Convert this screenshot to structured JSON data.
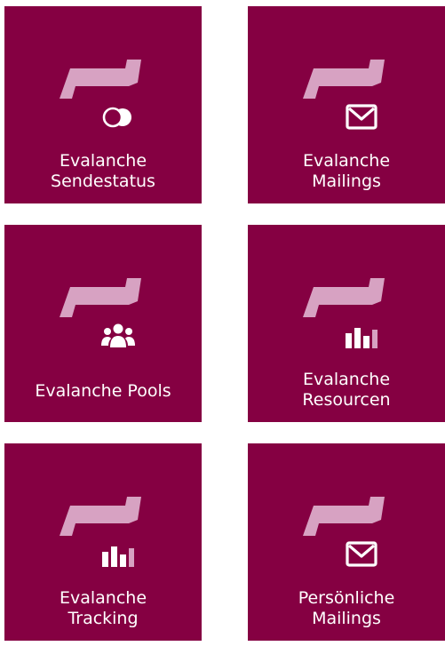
{
  "colors": {
    "tile_bg": "#850042",
    "logo": "#d7a2c2",
    "text": "#ffffff"
  },
  "tiles": [
    {
      "icon": "toggle-circles-icon",
      "label_line1": "Evalanche",
      "label_line2": "Sendestatus"
    },
    {
      "icon": "envelope-icon",
      "label_line1": "Evalanche",
      "label_line2": "Mailings"
    },
    {
      "icon": "people-group-icon",
      "label_line1": "Evalanche Pools",
      "label_line2": ""
    },
    {
      "icon": "bar-chart-icon",
      "label_line1": "Evalanche",
      "label_line2": "Resourcen"
    },
    {
      "icon": "bar-chart-icon",
      "label_line1": "Evalanche",
      "label_line2": "Tracking"
    },
    {
      "icon": "envelope-icon",
      "label_line1": "Persönliche",
      "label_line2": "Mailings"
    }
  ]
}
